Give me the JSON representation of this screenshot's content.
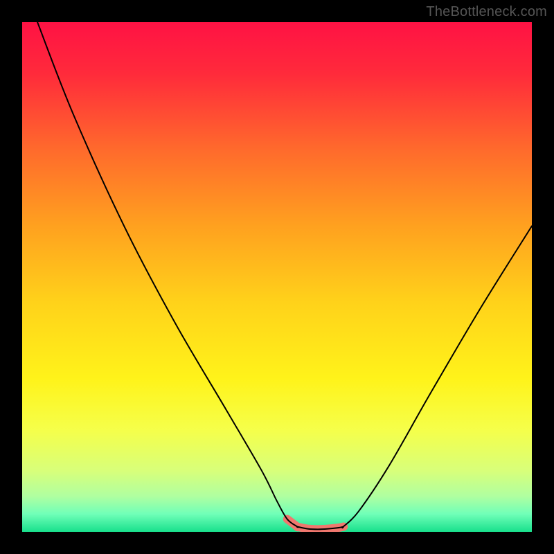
{
  "watermark": {
    "text": "TheBottleneck.com"
  },
  "colors": {
    "gradient_stops": [
      {
        "offset": 0.0,
        "color": "#ff1244"
      },
      {
        "offset": 0.1,
        "color": "#ff2a3b"
      },
      {
        "offset": 0.25,
        "color": "#ff6a2c"
      },
      {
        "offset": 0.4,
        "color": "#ffa11f"
      },
      {
        "offset": 0.55,
        "color": "#ffd21a"
      },
      {
        "offset": 0.7,
        "color": "#fff31a"
      },
      {
        "offset": 0.8,
        "color": "#f5ff4a"
      },
      {
        "offset": 0.88,
        "color": "#d8ff7a"
      },
      {
        "offset": 0.93,
        "color": "#b0ffa0"
      },
      {
        "offset": 0.965,
        "color": "#70ffb8"
      },
      {
        "offset": 1.0,
        "color": "#18e08c"
      }
    ],
    "curve": "#000000",
    "highlight": "#f0776e"
  },
  "chart_data": {
    "type": "line",
    "title": "",
    "xlabel": "",
    "ylabel": "",
    "xlim": [
      0,
      100
    ],
    "ylim": [
      0,
      100
    ],
    "grid": false,
    "legend": false,
    "series": [
      {
        "name": "left-branch",
        "x": [
          3,
          10,
          20,
          30,
          40,
          47,
          50,
          52,
          54
        ],
        "y": [
          100,
          82,
          60,
          41,
          24,
          12,
          6,
          2.5,
          1
        ]
      },
      {
        "name": "floor",
        "x": [
          54,
          56,
          58,
          60,
          62,
          63
        ],
        "y": [
          1,
          0.6,
          0.5,
          0.6,
          0.8,
          1
        ]
      },
      {
        "name": "right-branch",
        "x": [
          63,
          66,
          72,
          80,
          90,
          100
        ],
        "y": [
          1,
          4,
          13,
          27,
          44,
          60
        ]
      }
    ],
    "highlight_range_x": [
      52,
      64
    ],
    "notes": "V-shaped bottleneck curve over a vertical red→yellow→green gradient; y=0 means ideal match, higher y means more bottleneck. Values are estimated from the image."
  }
}
